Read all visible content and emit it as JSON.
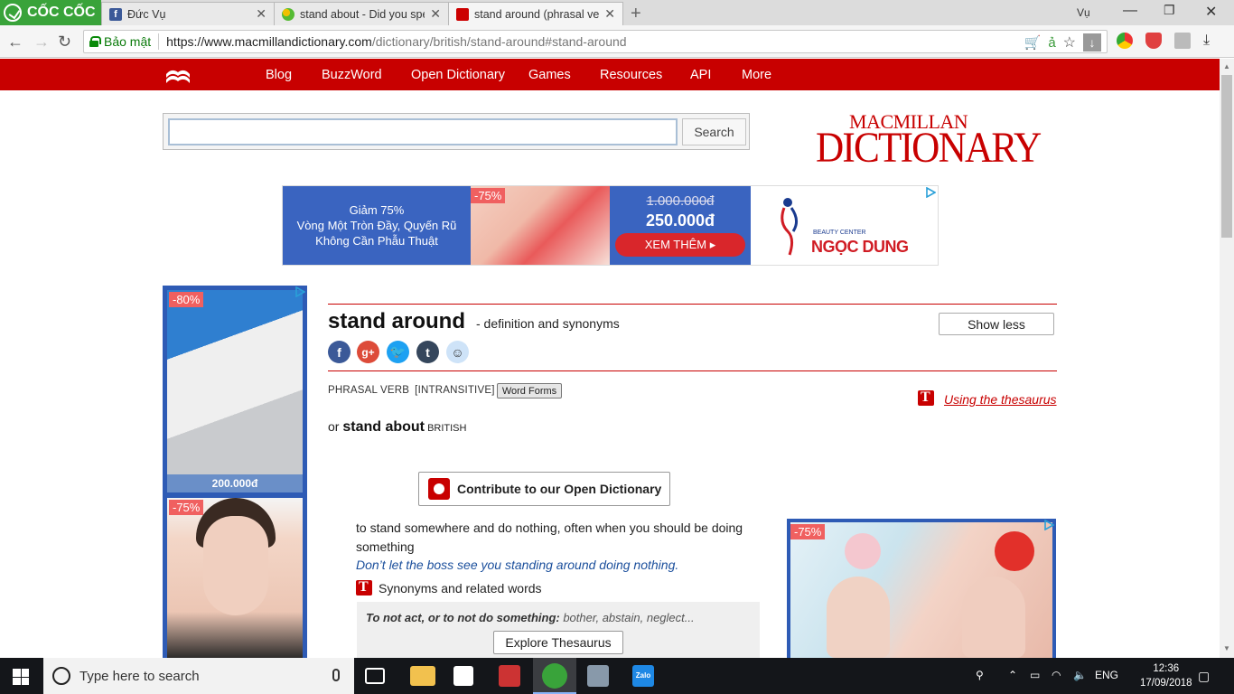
{
  "browser": {
    "brand": "CỐC CỐC",
    "tabs": [
      {
        "title": "Đức Vụ"
      },
      {
        "title": "stand about - Did you spell it"
      },
      {
        "title": "stand around (phrasal verb)"
      }
    ],
    "user": "Vụ",
    "secure_label": "Bảo mật",
    "url_host": "https://www.macmillandictionary.com",
    "url_path": "/dictionary/british/stand-around#stand-around"
  },
  "site": {
    "nav": [
      "Blog",
      "BuzzWord",
      "Open Dictionary",
      "Games",
      "Resources",
      "API",
      "More"
    ],
    "search_button": "Search",
    "search_value": "",
    "logo_top": "MACMILLAN",
    "logo_bottom": "DICTIONARY"
  },
  "banner_ad": {
    "line1": "Giảm 75%",
    "line2": "Vòng Một Tròn Đầy, Quyến Rũ",
    "line3": "Không Cần Phẫu Thuật",
    "discount": "-75%",
    "old_price": "1.000.000đ",
    "new_price": "250.000đ",
    "cta": "XEM THÊM ▸",
    "brand_small": "BEAUTY CENTER",
    "brand_name": "NGỌC DUNG"
  },
  "side_ad": {
    "discount1": "-80%",
    "price1": "200.000đ",
    "discount2": "-75%"
  },
  "right_ad": {
    "discount": "-75%"
  },
  "entry": {
    "headword": "stand around",
    "subtitle": "- definition and synonyms",
    "show_less": "Show less",
    "pos": "PHRASAL VERB",
    "pos_tag": "[INTRANSITIVE]",
    "word_forms": "Word Forms",
    "thesaurus_link": "Using the thesaurus",
    "variant_prefix": "or ",
    "variant_word": "stand about",
    "variant_region": " BRITISH",
    "contribute": "Contribute to our Open Dictionary",
    "definition": "to stand somewhere and do nothing, often when you should be doing something",
    "example": "Don’t let the boss see you standing around doing nothing.",
    "synonyms_title": "Synonyms and related words",
    "syn_heading": "To not act, or to not do something:",
    "syn_list": " bother, abstain, neglect...",
    "explore": "Explore Thesaurus"
  },
  "taskbar": {
    "search_placeholder": "Type here to search",
    "language": "ENG",
    "time": "12:36",
    "date": "17/09/2018"
  },
  "colors": {
    "brand_red": "#c80000",
    "coccoc_green": "#39a33a",
    "ad_blue": "#3a64c0"
  }
}
